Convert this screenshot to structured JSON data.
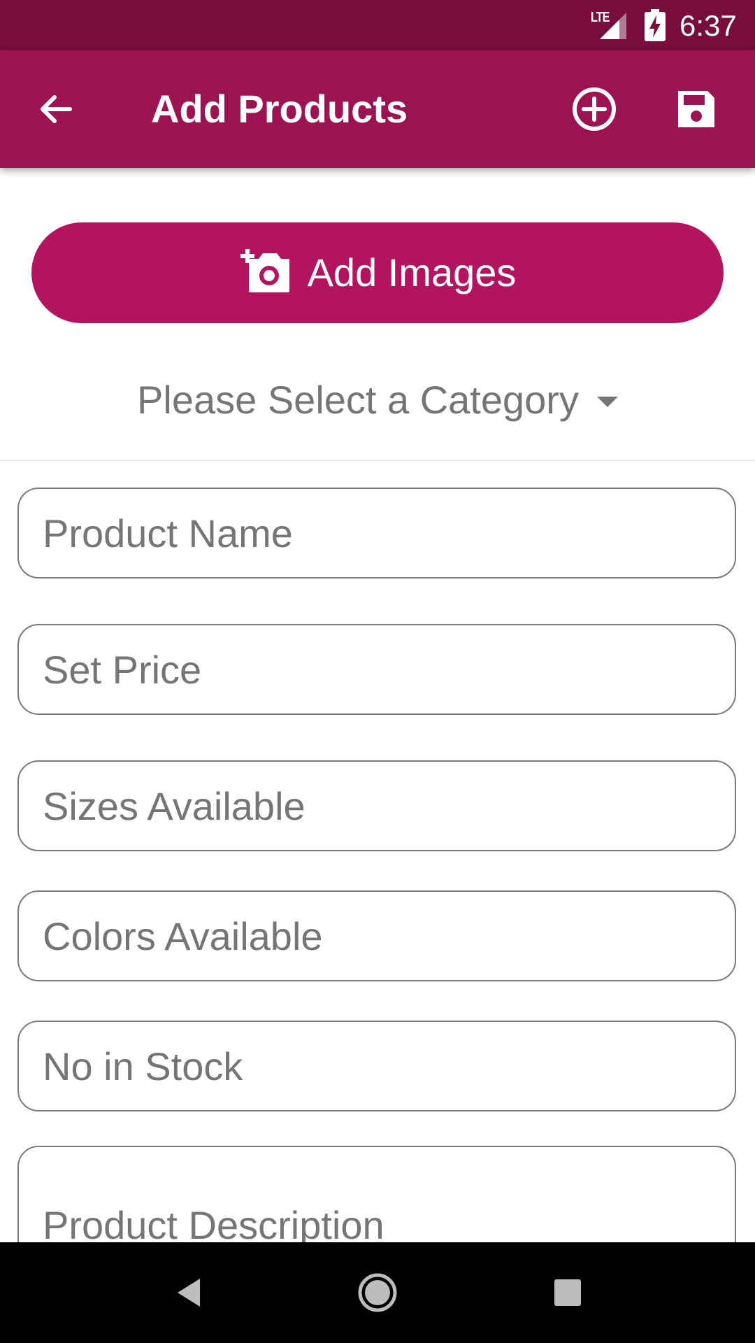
{
  "status_bar": {
    "network": "LTE",
    "time": "6:37",
    "icons": [
      "lte-signal-icon",
      "battery-charging-icon"
    ]
  },
  "app_bar": {
    "title": "Add Products",
    "back_icon": "arrow-back-icon",
    "add_icon": "add-circle-icon",
    "save_icon": "save-icon",
    "color": "#9c1354"
  },
  "add_images": {
    "label": "Add Images",
    "icon": "add-a-photo-icon",
    "color": "#b31460"
  },
  "category": {
    "selected": "Please Select a Category",
    "icon": "dropdown-caret-icon"
  },
  "form": {
    "product_name": {
      "placeholder": "Product Name",
      "value": ""
    },
    "price": {
      "placeholder": "Set Price",
      "value": ""
    },
    "sizes": {
      "placeholder": "Sizes Available",
      "value": ""
    },
    "colors": {
      "placeholder": "Colors Available",
      "value": ""
    },
    "stock": {
      "placeholder": "No in Stock",
      "value": ""
    },
    "description": {
      "placeholder": "Product Description",
      "value": ""
    }
  },
  "nav_bar": {
    "icons": [
      "nav-back-icon",
      "nav-home-icon",
      "nav-recents-icon"
    ]
  }
}
